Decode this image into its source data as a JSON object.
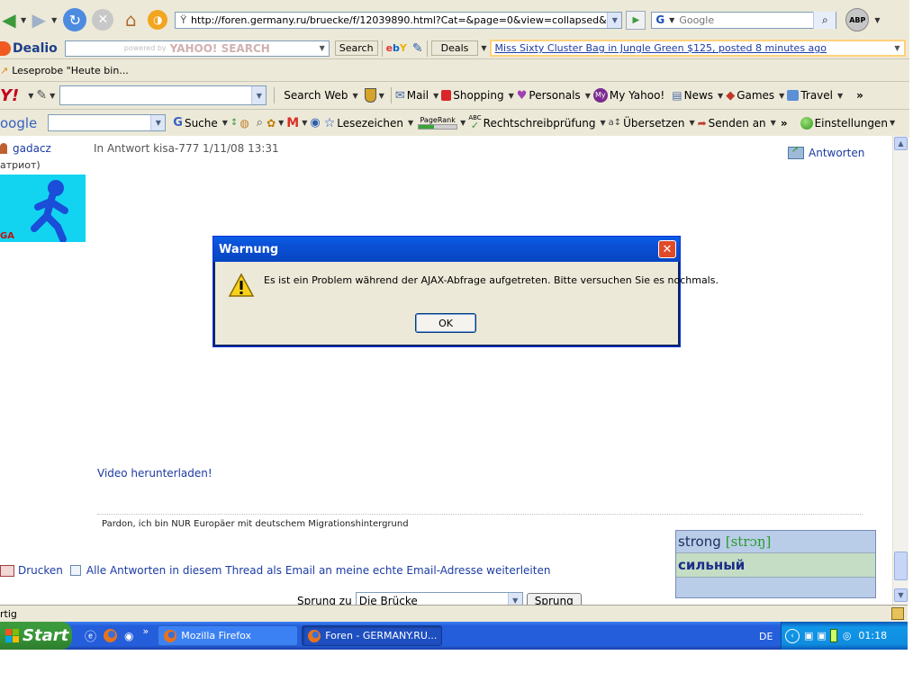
{
  "nav": {
    "url": "http://foren.germany.ru/bruecke/f/12039890.html?Cat=&page=0&view=collapsed&sb=5",
    "search_engine": "G",
    "search_placeholder": "Google",
    "abp_label": "ABP"
  },
  "dealio": {
    "brand": "Dealio",
    "powered_by": "powered by",
    "yahoo_search": "YAHOO! SEARCH",
    "search_btn": "Search",
    "deals_label": "Deals",
    "deal_text": "Miss Sixty Cluster Bag in Jungle Green $125, posted 8 minutes ago"
  },
  "bookmarks": {
    "item": "Leseprobe \"Heute bin..."
  },
  "yahoo_toolbar": {
    "logo": "Y!",
    "search_web": "Search Web",
    "mail": "Mail",
    "shopping": "Shopping",
    "personals": "Personals",
    "my_yahoo": "My Yahoo!",
    "news": "News",
    "games": "Games",
    "travel": "Travel",
    "more": "»"
  },
  "google_toolbar": {
    "logo": "oogle",
    "suche": "Suche",
    "lesezeichen": "Lesezeichen",
    "pagerank": "PageRank",
    "abc": "ABC",
    "rechtschreib": "Rechtschreibprüfung",
    "uebersetzen": "Übersetzen",
    "senden": "Senden an",
    "more": "»",
    "einstellungen": "Einstellungen"
  },
  "post": {
    "user": "gadacz",
    "user_subtitle": "атриот)",
    "avatar_text": "GA",
    "reply_info": "In Antwort kisa-777 1/11/08 13:31",
    "reply_button": "Antworten",
    "video_link": "Video herunterladen!",
    "signature": "Pardon, ich bin NUR Europäer mit deutschem Migrationshintergrund",
    "print_link": "Drucken",
    "email_link": "Alle Antworten in diesem Thread als Email an meine echte Email-Adresse weiterleiten",
    "jump_label": "Sprung zu",
    "jump_value": "Die Brücke",
    "jump_button": "Sprung"
  },
  "dialog": {
    "title": "Warnung",
    "message": "Es ist ein Problem während der AJAX-Abfrage aufgetreten. Bitte versuchen Sie es nochmals.",
    "ok": "OK"
  },
  "dictionary": {
    "word": "strong",
    "transcription": "[strɔŋ]",
    "translation": "сильный"
  },
  "status": {
    "text": "rtig"
  },
  "taskbar": {
    "start": "Start",
    "chevron": "»",
    "task1": "Mozilla Firefox",
    "task2": "Foren - GERMANY.RU...",
    "lang": "DE",
    "time": "01:18"
  }
}
